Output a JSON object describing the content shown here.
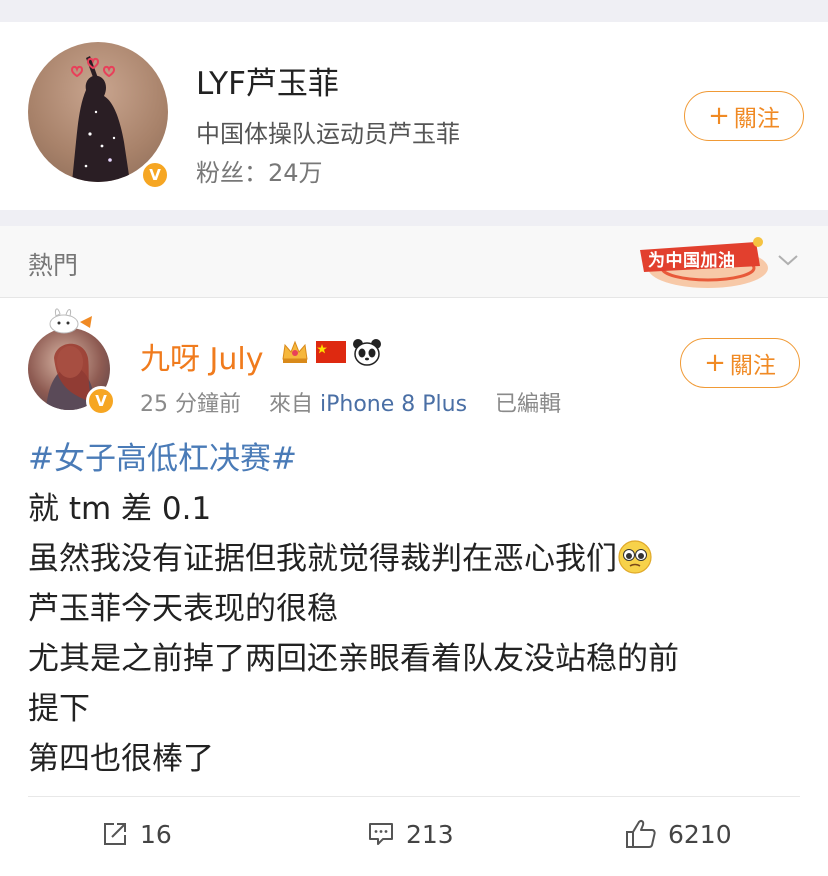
{
  "profile": {
    "name": "LYF芦玉菲",
    "description": "中国体操队运动员芦玉菲",
    "fans": "粉丝：24万",
    "follow_label": "關注",
    "verified_mark": "V"
  },
  "hot_bar": {
    "label": "熱門",
    "banner_text": "为中国加油"
  },
  "post": {
    "user_name": "九呀 July",
    "verified_mark": "V",
    "time": "25 分鐘前",
    "source_prefix": "來自",
    "source": "iPhone 8 Plus",
    "edited": "已編輯",
    "follow_label": "關注",
    "hashtag": "#女子高低杠决赛#",
    "lines": [
      "就 tm 差 0.1",
      "虽然我没有证据但我就觉得裁判在恶心我们",
      "芦玉菲今天表现的很稳",
      "尤其是之前掉了两回还亲眼看着队友没站稳的前",
      "提下",
      "第四也很棒了"
    ]
  },
  "actions": {
    "repost_count": "16",
    "comment_count": "213",
    "like_count": "6210"
  },
  "colors": {
    "accent_orange": "#f08a24",
    "link_blue": "#4a7bb7",
    "verify_gold": "#f6a623"
  }
}
